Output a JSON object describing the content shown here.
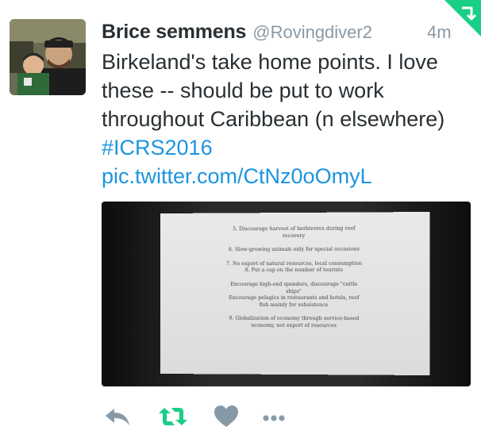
{
  "tweet": {
    "author": {
      "display_name": "Brice semmens",
      "handle": "@Rovingdiver2"
    },
    "timestamp": "4m",
    "text_lines": [
      "Birkeland's take home points. I love",
      "these -- should be put to work",
      "throughout Caribbean (n elsewhere)"
    ],
    "hashtag": "#ICRS2016",
    "pic_link": "pic.twitter.com/CtNz0oOmyL",
    "media": {
      "slide_lines": [
        "5. Discourage harvest of herbivores during reef",
        "recovery",
        "",
        "6. Slow-growing animals only for special occasions",
        "",
        "7. No export of natural resources, local consumption",
        "8. Put a cap on the number of tourists",
        "",
        "Encourage high-end spenders, discourage \"cattle",
        "ships\"",
        "Encourage pelagics in restaurants and hotels, reef",
        "fish mainly for subsistence",
        "",
        "9. Globalization of economy through service-based",
        "economy, not export of resources"
      ]
    },
    "actions": {
      "reply_icon": "reply-icon",
      "retweet_icon": "retweet-icon",
      "like_icon": "heart-icon",
      "more_icon": "more-icon"
    },
    "colors": {
      "name": "#292f33",
      "meta": "#8899a6",
      "link": "#1b95e0",
      "retweet": "#19cf86",
      "action_gray": "#8899a6"
    }
  }
}
